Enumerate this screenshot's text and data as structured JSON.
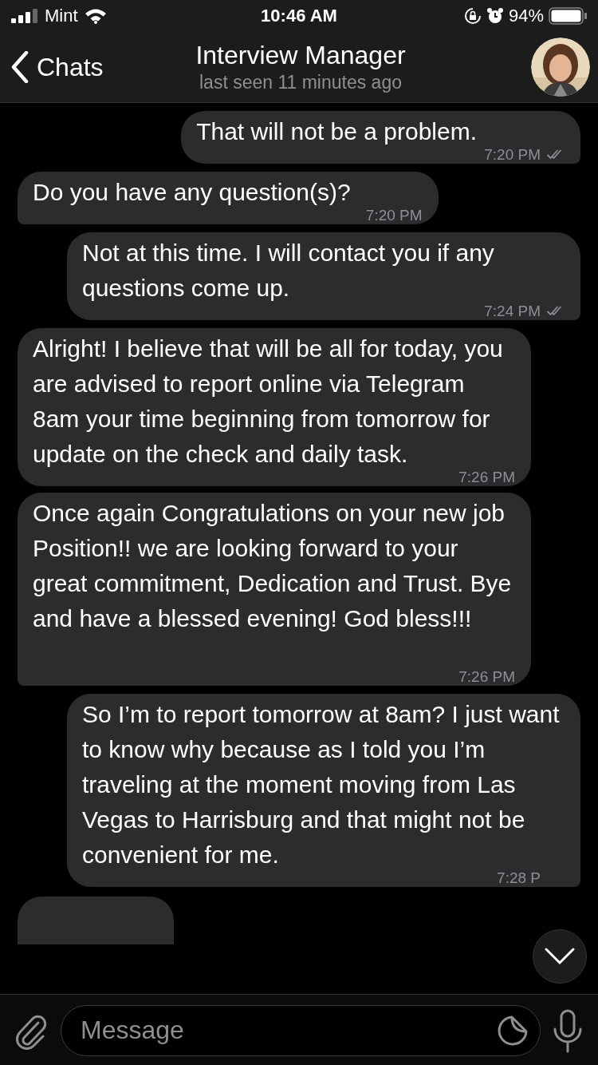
{
  "status_bar": {
    "carrier": "Mint",
    "time": "10:46 AM",
    "battery": "94%"
  },
  "header": {
    "back": "Chats",
    "title": "Interview Manager",
    "subtitle": "last seen 11 minutes ago"
  },
  "messages": [
    {
      "kind": "outgoing",
      "text": "That will not be a problem.",
      "time": "7:20 PM",
      "read": true
    },
    {
      "kind": "incoming",
      "text": "Do you have any question(s)?",
      "time": "7:20 PM"
    },
    {
      "kind": "outgoing",
      "text": "Not at this time. I will contact you if any questions come up.",
      "time": "7:24 PM",
      "read": true
    },
    {
      "kind": "incoming",
      "text": "Alright! I believe that will be all for today, you are advised to report online via Telegram 8am your time beginning from tomorrow for update on the check and daily task.",
      "time": "7:26 PM"
    },
    {
      "kind": "incoming",
      "text": "Once again Congratulations on your new job Position!! we are looking forward to your great commitment, Dedication and Trust. Bye and have a blessed evening! God bless!!!",
      "time": "7:26 PM"
    },
    {
      "kind": "outgoing",
      "text": "So I’m to report tomorrow at 8am? I just want to know why because as I told you I’m traveling at the moment moving from Las Vegas to Harrisburg and that might not be convenient for me.",
      "time": "7:28 P"
    }
  ],
  "composer": {
    "placeholder": "Message"
  }
}
